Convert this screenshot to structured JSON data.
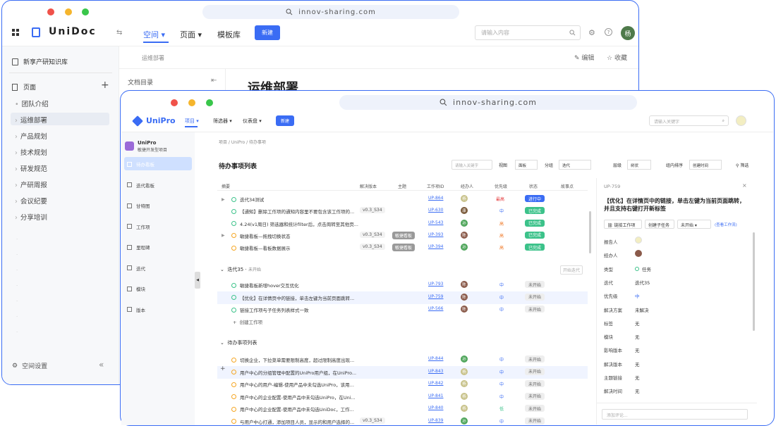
{
  "back": {
    "url": "innov-sharing.com",
    "app_name": "UniDoc",
    "nav": {
      "space": "空间",
      "page": "页面",
      "template": "模板库",
      "new": "新建"
    },
    "search_placeholder": "请输入内容",
    "avatar": "杨",
    "sidebar": {
      "kb": "新享产研知识库",
      "pages": "页面",
      "add": "+",
      "items": [
        "团队介绍",
        "运维部署",
        "产品规划",
        "技术规划",
        "研发规范",
        "产研周报",
        "会议纪要",
        "分享培训"
      ],
      "settings": "空间设置"
    },
    "breadcrumb": "运维部署",
    "edit": "编辑",
    "fav": "收藏",
    "toc": "文档目录",
    "doc_title": "运维部署"
  },
  "front": {
    "url": "innov-sharing.com",
    "app_name": "UniPro",
    "nav": {
      "project": "项目",
      "filter": "筛选器",
      "dashboard": "仪表盘",
      "new": "新建"
    },
    "search_placeholder": "请输入关键字",
    "project": {
      "name": "UniPro",
      "sub": "敏捷开发型项目"
    },
    "nav_items": [
      "待办看板",
      "迭代看板",
      "甘特图",
      "工作项",
      "里程碑",
      "迭代",
      "模块",
      "版本"
    ],
    "breadcrumb": "项目 / UniPro / 待办事项",
    "list_title": "待办事项列表",
    "toolbar": {
      "kw": "请输入关键字",
      "view": "视图",
      "view_val": "面板",
      "group": "分组",
      "group_val": "迭代",
      "level": "层级",
      "level_val": "树状",
      "sort": "组内排序",
      "sort_val": "创建时间",
      "filter": "筛选"
    },
    "columns": [
      "摘要",
      "解决版本",
      "主题",
      "工作项ID",
      "经办人",
      "优先级",
      "状态",
      "故事点"
    ],
    "group1_rows": [
      {
        "title": "迭代34测试",
        "ver": "",
        "theme": "",
        "id": "UP-864",
        "prio": "最高",
        "status": "进行中",
        "st": "run",
        "av": "杨"
      },
      {
        "title": "【通知】删除工作项的通知内容里不要包含该工作项的...",
        "ver": "v0.3_S34",
        "theme": "",
        "id": "UP-630",
        "prio": "中",
        "status": "已完成",
        "st": "done",
        "av": "康"
      },
      {
        "title": "4.24(v1周日) 筛选器和统计filter后，点击周转至其他页...",
        "ver": "",
        "theme": "",
        "id": "UP-543",
        "prio": "高",
        "status": "已完成",
        "st": "done",
        "av": "孙"
      },
      {
        "title": "敏捷看板—拖拽切换状态",
        "ver": "v0.3_S34",
        "theme": "敏捷看板",
        "id": "UP-393",
        "prio": "高",
        "status": "已完成",
        "st": "done",
        "av": "陈"
      },
      {
        "title": "敏捷看板—看板数据展示",
        "ver": "v0.3_S34",
        "theme": "敏捷看板",
        "id": "UP-394",
        "prio": "高",
        "status": "已完成",
        "st": "done",
        "av": "孙"
      }
    ],
    "group2": {
      "name": "迭代35",
      "state": "未开始",
      "action": "开始迭代"
    },
    "group2_rows": [
      {
        "title": "敏捷看板新增hover交互优化",
        "id": "UP-793",
        "prio": "中",
        "status": "未开始",
        "av": "陈"
      },
      {
        "title": "【优化】在详情页中的链接，单击左键为当前页面跳转...",
        "id": "UP-759",
        "prio": "中",
        "status": "未开始",
        "av": "陈"
      },
      {
        "title": "链接工作项与子任务列表样式一致",
        "id": "UP-566",
        "prio": "中",
        "status": "未开始",
        "av": "陈"
      }
    ],
    "create_item": "创建工作项",
    "group3": {
      "name": "待办事项列表"
    },
    "group3_rows": [
      {
        "title": "切换企业，下拉菜单需要限制高度，超过限制高度出现...",
        "ver": "",
        "id": "UP-844",
        "prio": "中",
        "status": "未开始",
        "av": "孙"
      },
      {
        "title": "用户中心的分组管理中配置的UniPro用户组，在UniPro...",
        "ver": "",
        "id": "UP-843",
        "prio": "中",
        "status": "未开始",
        "av": "杨"
      },
      {
        "title": "用户中心的用户-编辑-使用产品中未勾选UniPro，该用...",
        "ver": "",
        "id": "UP-842",
        "prio": "中",
        "status": "未开始",
        "av": "杨"
      },
      {
        "title": "用户中心的企业配置-使用产品中未勾选UniPro，在Uni...",
        "ver": "",
        "id": "UP-841",
        "prio": "中",
        "status": "未开始",
        "av": "杨"
      },
      {
        "title": "用户中心的企业配置-使用产品中未勾选UniDoc，工作...",
        "ver": "",
        "id": "UP-840",
        "prio": "低",
        "status": "未开始",
        "av": "杨"
      },
      {
        "title": "与用户中心打通，添加项目人员，显示的和用户选择的...",
        "ver": "v0.3_S34",
        "id": "UP-839",
        "prio": "中",
        "status": "未开始",
        "av": "孙"
      }
    ],
    "detail": {
      "id": "UP-759",
      "title": "【优化】在详情页中的链接，单击左键为当前页面跳转，并且支持右键打开新标签",
      "link_btn": "链接工作项",
      "sub_btn": "创建子任务",
      "status": "未开始",
      "view": "(查看工作流)",
      "fields": [
        [
          "报告人",
          ""
        ],
        [
          "经办人",
          ""
        ],
        [
          "类型",
          "任务"
        ],
        [
          "迭代",
          "迭代35"
        ],
        [
          "优先级",
          "中"
        ],
        [
          "解决方案",
          "未解决"
        ],
        [
          "标签",
          "无"
        ],
        [
          "模块",
          "无"
        ],
        [
          "影响版本",
          "无"
        ],
        [
          "解决版本",
          "无"
        ],
        [
          "主题链接",
          "无"
        ],
        [
          "解决时间",
          "无"
        ]
      ],
      "comment": "添加评论..."
    }
  },
  "colors": {
    "accent": "#3a6cf4",
    "done": "#3cc28a",
    "high": "#f07a2a",
    "mid": "#3a6cf4",
    "low": "#3cc28a"
  }
}
